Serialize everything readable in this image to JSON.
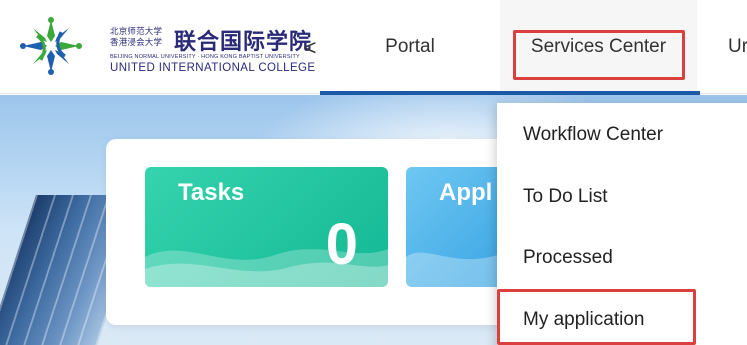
{
  "logo": {
    "cn_small_line1": "北京师范大学",
    "cn_small_line2": "香港浸会大学",
    "cn_name": "联合国际学院",
    "en_small": "BEIJING NORMAL UNIVERSITY · HONG KONG BAPTIST UNIVERSITY",
    "en_name": "UNITED INTERNATIONAL COLLEGE"
  },
  "header": {
    "collapse_glyph": "<",
    "tabs": [
      {
        "label": "Portal",
        "selected": true
      },
      {
        "label": "Services Center",
        "highlighted": true
      },
      {
        "label": "Ur"
      }
    ]
  },
  "dashboard": {
    "tasks": {
      "label": "Tasks",
      "value": "0"
    },
    "apply": {
      "label": "Appl"
    }
  },
  "dropdown": {
    "items": [
      {
        "label": "Workflow Center"
      },
      {
        "label": "To Do List"
      },
      {
        "label": "Processed"
      },
      {
        "label": "My application",
        "highlighted": true
      }
    ]
  },
  "colors": {
    "accent": "#1c5aa7",
    "highlight": "#d9403f",
    "tasks_card": "#14b894",
    "apply_card": "#3aa5e4"
  },
  "icons": [
    "college-logo-icon",
    "chevron-left-icon"
  ]
}
